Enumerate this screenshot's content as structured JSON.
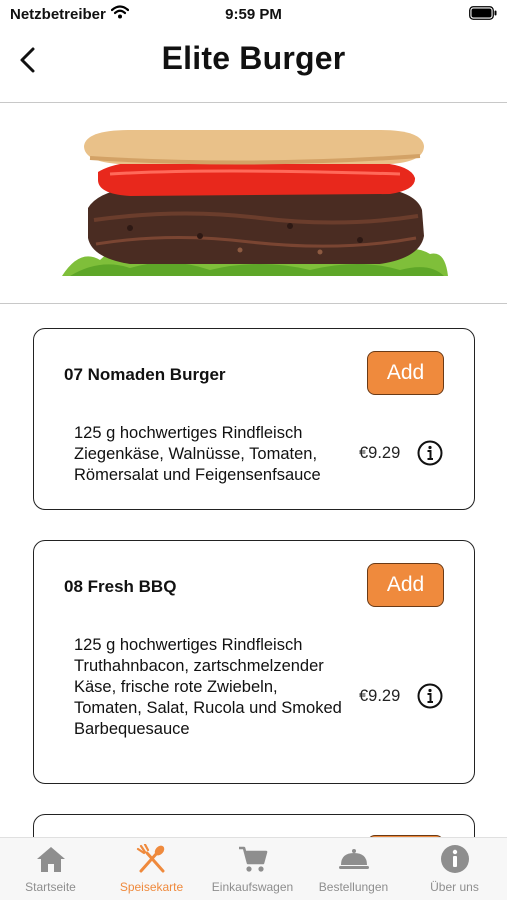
{
  "status_bar": {
    "carrier": "Netzbetreiber",
    "time": "9:59 PM"
  },
  "header": {
    "title": "Elite Burger"
  },
  "menu_items": [
    {
      "name": "07 Nomaden Burger",
      "add_label": "Add",
      "description": "125 g hochwertiges Rindfleisch Ziegenkäse, Walnüsse, Tomaten, Römersalat und Feigensenfsauce",
      "price": "€9.29"
    },
    {
      "name": "08 Fresh BBQ",
      "add_label": "Add",
      "description": "125 g hochwertiges Rindfleisch Truthahnbacon, zartschmelzender Käse, frische rote Zwiebeln, Tomaten, Salat, Rucola und Smoked Barbequesauce",
      "price": "€9.29"
    }
  ],
  "tab_bar": {
    "active_index": 1,
    "accent_color": "#ef8a3d",
    "inactive_color": "#8e8e8e",
    "tabs": [
      {
        "label": "Startseite",
        "icon": "home-icon"
      },
      {
        "label": "Speisekarte",
        "icon": "fork-knife-icon"
      },
      {
        "label": "Einkaufswagen",
        "icon": "cart-icon"
      },
      {
        "label": "Bestellungen",
        "icon": "cloche-icon"
      },
      {
        "label": "Über uns",
        "icon": "info-icon"
      }
    ]
  }
}
